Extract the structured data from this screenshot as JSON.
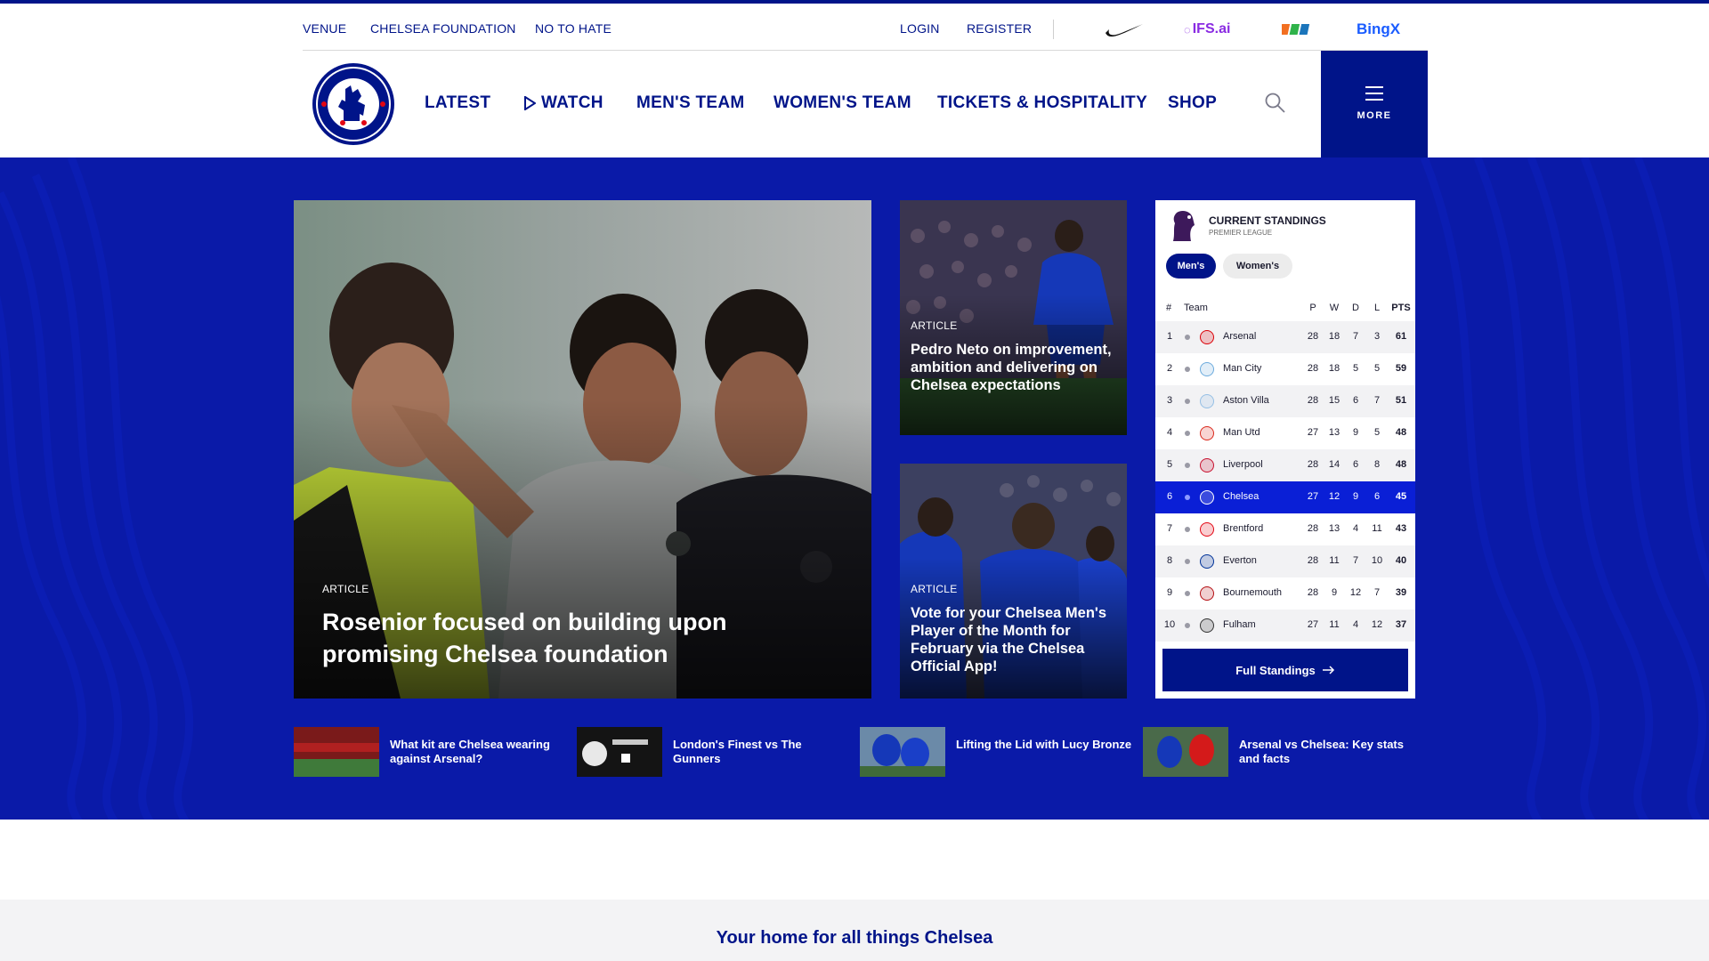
{
  "utility": {
    "links": [
      "VENUE",
      "CHELSEA FOUNDATION",
      "NO TO HATE"
    ],
    "login": "LOGIN",
    "register": "REGISTER",
    "sponsors": {
      "ifs": "IFS.ai",
      "bingx": "BingX"
    }
  },
  "nav": {
    "items": [
      "LATEST",
      "WATCH",
      "MEN'S TEAM",
      "WOMEN'S TEAM",
      "TICKETS & HOSPITALITY",
      "SHOP"
    ],
    "more": "MORE"
  },
  "hero": {
    "main": {
      "tag": "ARTICLE",
      "title": "Rosenior focused on building upon promising Chelsea foundation"
    },
    "side1": {
      "tag": "ARTICLE",
      "title": "Pedro Neto on improvement, ambition and delivering on Chelsea expectations"
    },
    "side2": {
      "tag": "ARTICLE",
      "title": "Vote for your Chelsea Men's Player of the Month for February via the Chelsea Official App!"
    }
  },
  "standings": {
    "title": "CURRENT STANDINGS",
    "subtitle": "PREMIER LEAGUE",
    "tabs": {
      "men": "Men's",
      "women": "Women's"
    },
    "headers": {
      "pos": "#",
      "team": "Team",
      "p": "P",
      "w": "W",
      "d": "D",
      "l": "L",
      "pts": "PTS"
    },
    "rows": [
      {
        "pos": "1",
        "team": "Arsenal",
        "p": "28",
        "w": "18",
        "d": "7",
        "l": "3",
        "pts": "61",
        "color": "#db0007"
      },
      {
        "pos": "2",
        "team": "Man City",
        "p": "28",
        "w": "18",
        "d": "5",
        "l": "5",
        "pts": "59",
        "color": "#6cabdd"
      },
      {
        "pos": "3",
        "team": "Aston Villa",
        "p": "28",
        "w": "15",
        "d": "6",
        "l": "7",
        "pts": "51",
        "color": "#95bfe5"
      },
      {
        "pos": "4",
        "team": "Man Utd",
        "p": "27",
        "w": "13",
        "d": "9",
        "l": "5",
        "pts": "48",
        "color": "#da291c"
      },
      {
        "pos": "5",
        "team": "Liverpool",
        "p": "28",
        "w": "14",
        "d": "6",
        "l": "8",
        "pts": "48",
        "color": "#c8102e"
      },
      {
        "pos": "6",
        "team": "Chelsea",
        "p": "27",
        "w": "12",
        "d": "9",
        "l": "6",
        "pts": "45",
        "color": "#ffffff"
      },
      {
        "pos": "7",
        "team": "Brentford",
        "p": "28",
        "w": "13",
        "d": "4",
        "l": "11",
        "pts": "43",
        "color": "#e30613"
      },
      {
        "pos": "8",
        "team": "Everton",
        "p": "28",
        "w": "11",
        "d": "7",
        "l": "10",
        "pts": "40",
        "color": "#003399"
      },
      {
        "pos": "9",
        "team": "Bournemouth",
        "p": "28",
        "w": "9",
        "d": "12",
        "l": "7",
        "pts": "39",
        "color": "#b50e12"
      },
      {
        "pos": "10",
        "team": "Fulham",
        "p": "27",
        "w": "11",
        "d": "4",
        "l": "12",
        "pts": "37",
        "color": "#333333"
      }
    ],
    "full_button": "Full Standings"
  },
  "small_cards": [
    {
      "title": "What kit are Chelsea wearing against Arsenal?"
    },
    {
      "title": "London's Finest vs The Gunners"
    },
    {
      "title": "Lifting the Lid with Lucy Bronze"
    },
    {
      "title": "Arsenal vs Chelsea: Key stats and facts"
    }
  ],
  "home": {
    "title": "Your home for all things Chelsea"
  },
  "colors": {
    "brand": "#001489",
    "hero_bg": "#0a1aa8",
    "highlight_row": "#0a1fd6"
  }
}
